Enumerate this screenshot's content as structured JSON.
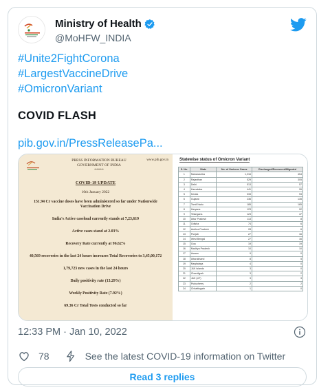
{
  "account": {
    "name": "Ministry of Health",
    "handle": "@MoHFW_INDIA"
  },
  "tweet": {
    "hashtags": [
      "#Unite2FightCorona",
      "#LargestVaccineDrive",
      "#OmicronVariant"
    ],
    "flash": "COVID FLASH",
    "link": "pib.gov.in/PressReleasePa...",
    "timestamp": "12:33 PM · Jan 10, 2022",
    "likes": "78",
    "covid_info": "See the latest COVID-19 information on Twitter",
    "replies_button": "Read 3 replies"
  },
  "media": {
    "bureau_line1": "PRESS INFORMATION BUREAU",
    "bureau_line2": "GOVERNMENT OF INDIA",
    "website": "www.pib.gov.in",
    "stars": "*****",
    "update_title": "COVID-19 UPDATE",
    "update_date": "10th January 2022",
    "items": [
      "151.94 Cr vaccine doses have been administered so far under Nationwide Vaccination Drive",
      "India's Active caseload currently stands at 7,23,619",
      "Active cases stand at 2.03%",
      "Recovery Rate currently at 96.62%",
      "40,569 recoveries in the last 24 hours increases Total Recoveries to 3,45,00,172",
      "1,79,723 new cases in the last 24 hours",
      "Daily positivity rate (13.29%)",
      "Weekly Positivity Rate (7.92%)",
      "69.36 Cr Total Tests conducted so far"
    ],
    "table_title": "Statewise status of Omicron Variant",
    "table_headers": [
      "S. No.",
      "State",
      "No. of Omicron Cases",
      "Discharged/Recovered/Migrated"
    ],
    "table_rows": [
      [
        "1",
        "Maharashtra",
        "1,216",
        "454"
      ],
      [
        "2",
        "Rajasthan",
        "529",
        "305"
      ],
      [
        "3",
        "Delhi",
        "513",
        "57"
      ],
      [
        "4",
        "Karnataka",
        "441",
        "26"
      ],
      [
        "5",
        "Kerala",
        "333",
        "93"
      ],
      [
        "6",
        "Gujarat",
        "236",
        "135"
      ],
      [
        "7",
        "Tamil Nadu",
        "185",
        "185"
      ],
      [
        "8",
        "Haryana",
        "123",
        "92"
      ],
      [
        "9",
        "Telangana",
        "123",
        "47"
      ],
      [
        "10",
        "Uttar Pradesh",
        "113",
        "8"
      ],
      [
        "11",
        "Odisha",
        "74",
        "6"
      ],
      [
        "12",
        "Andhra Pradesh",
        "28",
        "6"
      ],
      [
        "13",
        "Punjab",
        "27",
        "16"
      ],
      [
        "14",
        "West Bengal",
        "27",
        "16"
      ],
      [
        "15",
        "Goa",
        "19",
        "19"
      ],
      [
        "16",
        "Madhya Pradesh",
        "10",
        "10"
      ],
      [
        "17",
        "Assam",
        "9",
        "0"
      ],
      [
        "18",
        "Uttarakhand",
        "8",
        "5"
      ],
      [
        "19",
        "Meghalaya",
        "4",
        "0"
      ],
      [
        "20",
        "J&K Islands",
        "3",
        "0"
      ],
      [
        "21",
        "Chandigarh",
        "3",
        "2"
      ],
      [
        "22",
        "J&K (UT)",
        "3",
        "3"
      ],
      [
        "23",
        "Puducherry",
        "2",
        "2"
      ],
      [
        "24",
        "Chhattisgarh",
        "1",
        "0"
      ]
    ]
  },
  "colors": {
    "accent": "#1d9bf0",
    "muted": "#536471",
    "border": "#cfd9de",
    "doc_background": "#f4e9d3"
  },
  "icons": [
    "verified-badge-icon",
    "twitter-bird-icon",
    "info-icon",
    "heart-icon",
    "bolt-icon"
  ]
}
